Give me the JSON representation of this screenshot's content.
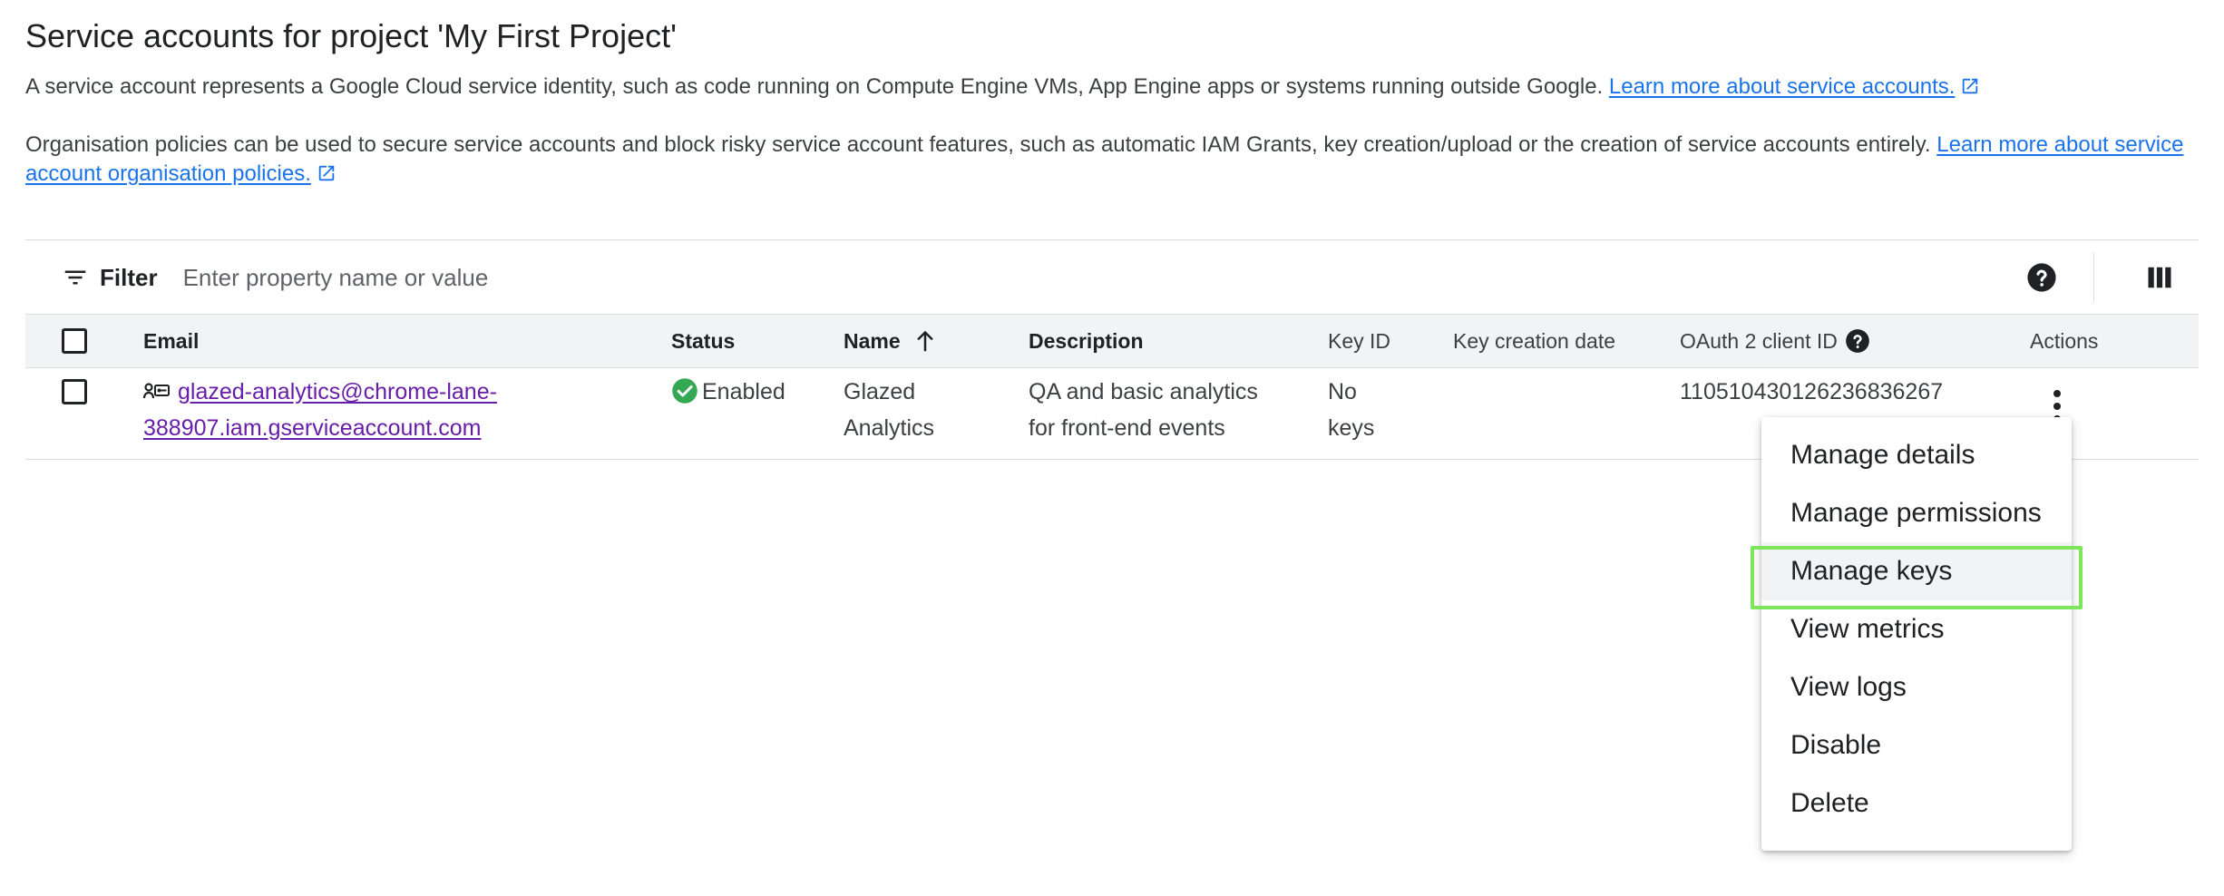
{
  "page": {
    "title": "Service accounts for project 'My First Project'",
    "intro_text": "A service account represents a Google Cloud service identity, such as code running on Compute Engine VMs, App Engine apps or systems running outside Google. ",
    "intro_link": "Learn more about service accounts.",
    "policy_text": "Organisation policies can be used to secure service accounts and block risky service account features, such as automatic IAM Grants, key creation/upload or the creation of service accounts entirely. ",
    "policy_link": "Learn more about service account organisation policies."
  },
  "filter": {
    "label": "Filter",
    "placeholder": "Enter property name or value"
  },
  "table": {
    "columns": {
      "email": "Email",
      "status": "Status",
      "name": "Name",
      "description": "Description",
      "key_id": "Key ID",
      "key_creation_date": "Key creation date",
      "oauth_client_id": "OAuth 2 client ID",
      "actions": "Actions"
    },
    "rows": [
      {
        "email_line1": "glazed-analytics@chrome-lane-",
        "email_line2": "388907.iam.gserviceaccount.com",
        "status": "Enabled",
        "name_line1": "Glazed",
        "name_line2": "Analytics",
        "description_line1": "QA and basic analytics",
        "description_line2": "for front-end events",
        "key_id_line1": "No",
        "key_id_line2": "keys",
        "key_creation_date": "",
        "oauth_client_id": "110510430126236836267"
      }
    ]
  },
  "actions_menu": {
    "items": [
      "Manage details",
      "Manage permissions",
      "Manage keys",
      "View metrics",
      "View logs",
      "Disable",
      "Delete"
    ],
    "highlighted": "Manage keys"
  },
  "colors": {
    "link": "#1a73e8",
    "visited_link": "#681da8",
    "status_enabled": "#34a853",
    "highlight_box": "#7ee65a"
  },
  "icons": {
    "filter": "filter-icon",
    "help": "help-icon",
    "columns": "column-display-icon",
    "service_account": "service-account-key-icon",
    "status": "check-circle-icon",
    "sort": "arrow-up-icon",
    "more": "more-vert-icon",
    "external": "open-in-new-icon"
  }
}
